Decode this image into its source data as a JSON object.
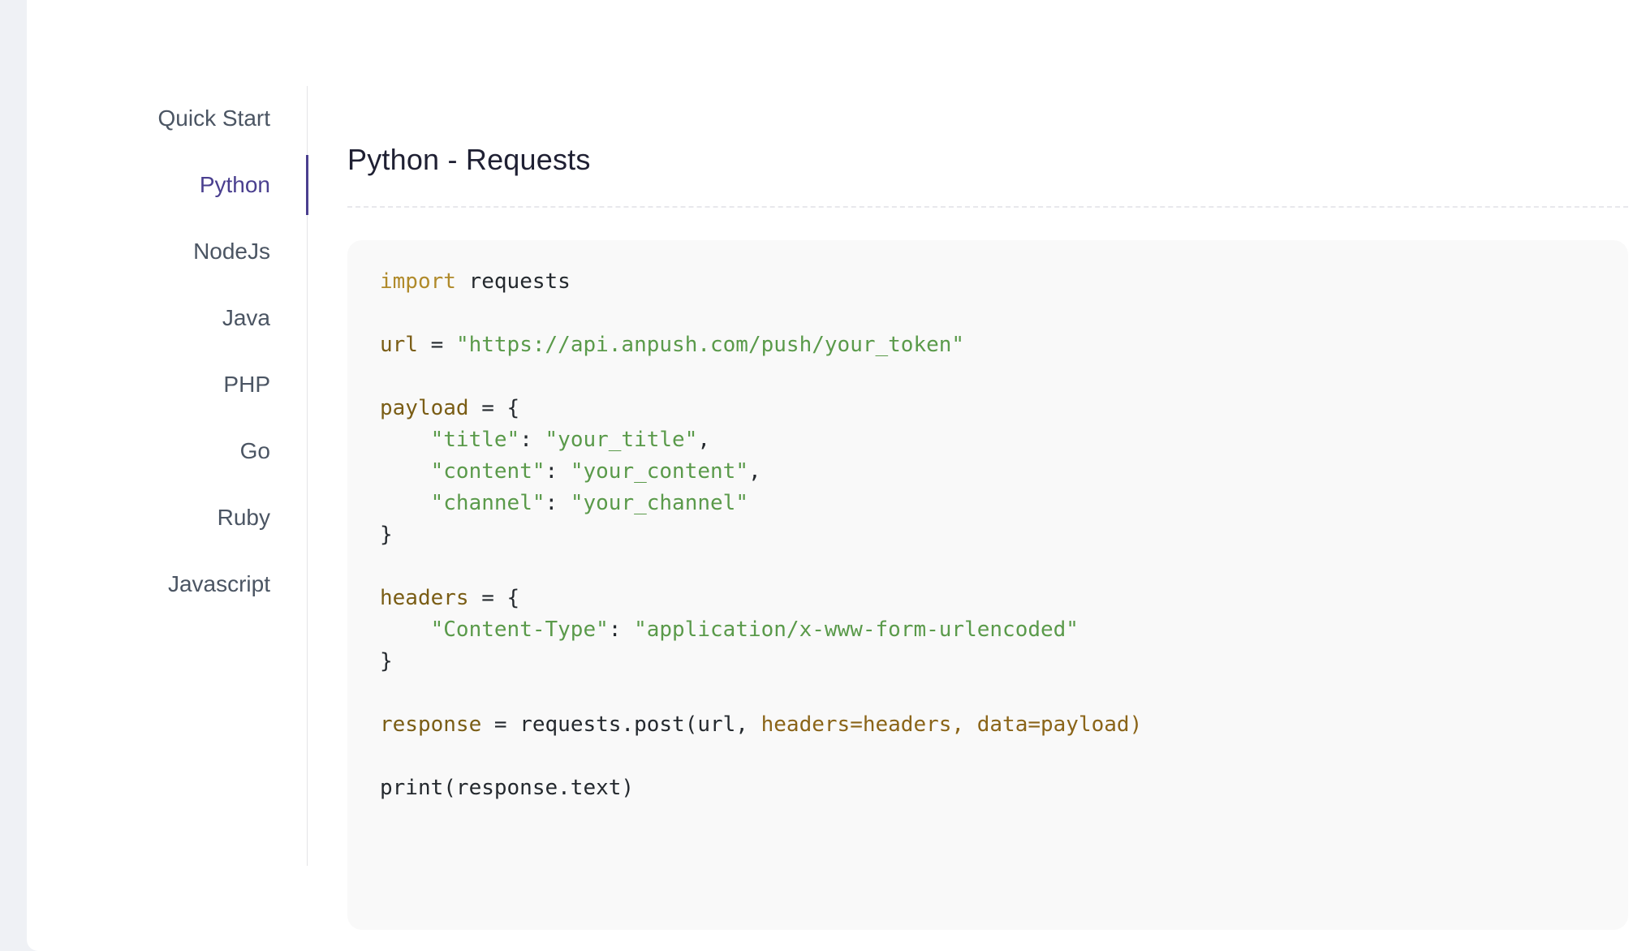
{
  "sidebar": {
    "items": [
      {
        "label": "Quick Start",
        "active": false
      },
      {
        "label": "Python",
        "active": true
      },
      {
        "label": "NodeJs",
        "active": false
      },
      {
        "label": "Java",
        "active": false
      },
      {
        "label": "PHP",
        "active": false
      },
      {
        "label": "Go",
        "active": false
      },
      {
        "label": "Ruby",
        "active": false
      },
      {
        "label": "Javascript",
        "active": false
      }
    ]
  },
  "main": {
    "title": "Python - Requests",
    "code": {
      "language": "python",
      "import_keyword": "import",
      "import_module": " requests",
      "url_var": "url",
      "assign": " = ",
      "url_value": "\"https://api.anpush.com/push/your_token\"",
      "payload_var": "payload",
      "open_brace": " = {",
      "title_key": "\"title\"",
      "title_value": "\"your_title\"",
      "content_key": "\"content\"",
      "content_value": "\"your_content\"",
      "channel_key": "\"channel\"",
      "channel_value": "\"your_channel\"",
      "close_brace": "}",
      "headers_var": "headers",
      "ct_key": "\"Content-Type\"",
      "ct_value": "\"application/x-www-form-urlencoded\"",
      "response_var": "response",
      "call": "requests.post(url, ",
      "call_args": "headers=headers, data=payload)",
      "print_line": "print(response.text)",
      "colon": ": ",
      "comma": ","
    }
  },
  "colors": {
    "accent": "#4a3f8f",
    "keyword": "#b08a2a",
    "variable": "#7a5d15",
    "string": "#5a9a4a",
    "background": "#eff1f5"
  }
}
